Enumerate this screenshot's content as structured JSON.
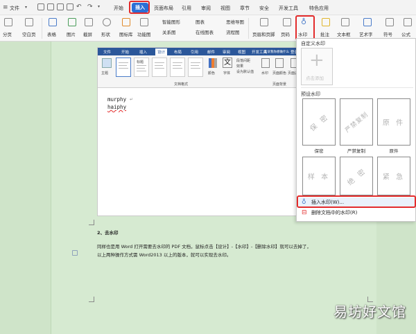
{
  "menubar": {
    "app_menu": "文件",
    "tabs": [
      "开始",
      "插入",
      "页面布局",
      "引用",
      "审阅",
      "视图",
      "章节",
      "安全",
      "开发工具",
      "特色应用"
    ],
    "active_tab": "插入"
  },
  "ribbon": {
    "groups": [
      "分页",
      "空白页",
      "表格",
      "图片",
      "截屏",
      "形状",
      "图标库",
      "功能图",
      "智能图形",
      "关系图",
      "图表",
      "在线图表",
      "思维导图",
      "流程图",
      "页眉和页脚",
      "页码",
      "水印",
      "批注",
      "文本框",
      "艺术字",
      "符号",
      "公式"
    ]
  },
  "screenshot": {
    "tabs": [
      "文件",
      "开始",
      "插入",
      "设计",
      "布局",
      "引用",
      "邮件",
      "审阅",
      "视图",
      "开发工具",
      "告诉我你想做什么",
      "登录"
    ],
    "active_tab": "设计",
    "ribbon": {
      "theme": "主题",
      "thumb_title": "标题",
      "colors": "颜色",
      "fonts": "字体",
      "paragraph_spacing": "段落间距",
      "effects": "效果",
      "set_default": "设为默认值",
      "watermark": "水印",
      "page_color": "页面颜色",
      "page_border": "页面边框",
      "group_doc_format": "文档格式",
      "group_page_bg": "页面背景"
    },
    "doc_lines": [
      "murphy",
      "haiphy"
    ]
  },
  "document": {
    "heading": "2、去水印",
    "para1": "同样也是用 Word 打开需要去水印的 PDF 文档，鼠标点击【设计】-【水印】-【删除水印】就可以去掉了，",
    "para2": "以上两种操作方式需 Word2013 以上的版本，就可以实现去水印。"
  },
  "dropdown": {
    "custom_section": "自定义水印",
    "add_label": "点击添加",
    "preset_section": "预设水印",
    "presets": [
      {
        "text": "保 密",
        "label": "保密"
      },
      {
        "text": "严禁复制",
        "label": "严禁复制"
      },
      {
        "text": "原 件",
        "label": "原件"
      },
      {
        "text": "样 本",
        "label": ""
      },
      {
        "text": "绝 密",
        "label": ""
      },
      {
        "text": "紧 急",
        "label": ""
      }
    ],
    "insert_item": "插入水印(W)...",
    "delete_item": "删除文档中的水印(R)"
  },
  "credit": "易坊好文馆",
  "colors": {
    "accent": "#2b6fd6",
    "highlight": "#e32b2b",
    "word_blue": "#2b579a"
  }
}
